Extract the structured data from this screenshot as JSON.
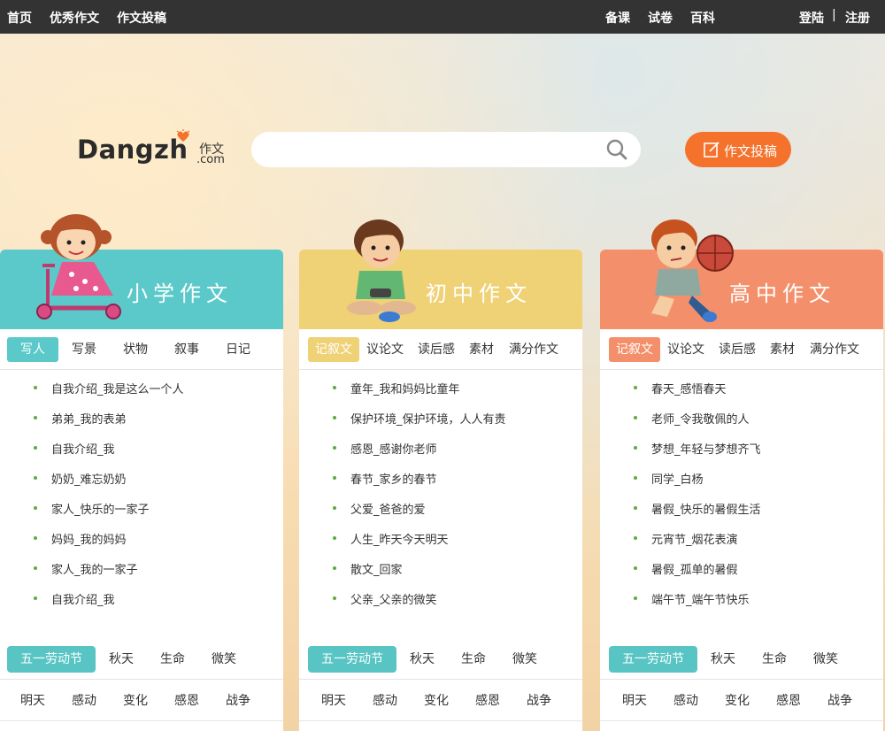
{
  "topnav": {
    "left": [
      "首页",
      "优秀作文",
      "作文投稿"
    ],
    "middle": [
      "备课",
      "试卷",
      "百科"
    ],
    "login": "登陆",
    "separator": "|",
    "register": "注册"
  },
  "logo": {
    "word": "Dangzh",
    "cn": "作文",
    "com": ".com"
  },
  "search": {
    "placeholder": "",
    "value": ""
  },
  "submit_button": {
    "label": "作文投稿"
  },
  "colors": {
    "primary": "#5bc9c9",
    "middle": "#efd176",
    "high": "#f3906b",
    "tag_active": "#58c5c4",
    "submit": "#f4722b"
  },
  "columns": [
    {
      "title": "小学作文",
      "tabs": [
        "写人",
        "写景",
        "状物",
        "叙事",
        "日记"
      ],
      "active_tab": 0,
      "items": [
        "自我介绍_我是这么一个人",
        "弟弟_我的表弟",
        "自我介绍_我",
        "奶奶_难忘奶奶",
        "家人_快乐的一家子",
        "妈妈_我的妈妈",
        "家人_我的一家子",
        "自我介绍_我"
      ],
      "tags1": [
        "五一劳动节",
        "秋天",
        "生命",
        "微笑"
      ],
      "tags2": [
        "明天",
        "感动",
        "变化",
        "感恩",
        "战争"
      ]
    },
    {
      "title": "初中作文",
      "tabs": [
        "记叙文",
        "议论文",
        "读后感",
        "素材",
        "满分作文"
      ],
      "active_tab": 0,
      "items": [
        "童年_我和妈妈比童年",
        "保护环境_保护环境，人人有责",
        "感恩_感谢你老师",
        "春节_家乡的春节",
        "父爱_爸爸的爱",
        "人生_昨天今天明天",
        "散文_回家",
        "父亲_父亲的微笑"
      ],
      "tags1": [
        "五一劳动节",
        "秋天",
        "生命",
        "微笑"
      ],
      "tags2": [
        "明天",
        "感动",
        "变化",
        "感恩",
        "战争"
      ]
    },
    {
      "title": "高中作文",
      "tabs": [
        "记叙文",
        "议论文",
        "读后感",
        "素材",
        "满分作文"
      ],
      "active_tab": 0,
      "items": [
        "春天_感悟春天",
        "老师_令我敬佩的人",
        "梦想_年轻与梦想齐飞",
        "同学_白杨",
        "暑假_快乐的暑假生活",
        "元宵节_烟花表演",
        "暑假_孤单的暑假",
        "端午节_端午节快乐"
      ],
      "tags1": [
        "五一劳动节",
        "秋天",
        "生命",
        "微笑"
      ],
      "tags2": [
        "明天",
        "感动",
        "变化",
        "感恩",
        "战争"
      ]
    }
  ]
}
